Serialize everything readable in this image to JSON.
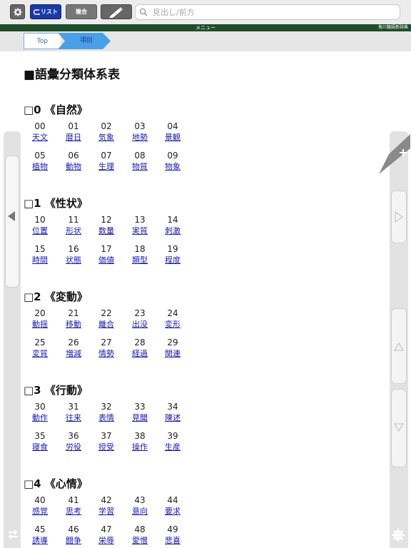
{
  "toolbar": {
    "list_label": "リスト",
    "multi_label": "複合",
    "search_placeholder": "見出し/前方"
  },
  "menubar": {
    "title": "メニュー",
    "dict_name": "角川類語新辞典"
  },
  "breadcrumb": {
    "top": "Top",
    "item": "項目"
  },
  "page_title": "■語彙分類体系表",
  "sections": [
    {
      "heading": "□0 《自然》",
      "rows": [
        [
          [
            "00",
            "天文"
          ],
          [
            "01",
            "暦日"
          ],
          [
            "02",
            "気象"
          ],
          [
            "03",
            "地勢"
          ],
          [
            "04",
            "景観"
          ]
        ],
        [
          [
            "05",
            "植物"
          ],
          [
            "06",
            "動物"
          ],
          [
            "07",
            "生理"
          ],
          [
            "08",
            "物質"
          ],
          [
            "09",
            "物象"
          ]
        ]
      ]
    },
    {
      "heading": "□1 《性状》",
      "rows": [
        [
          [
            "10",
            "位置"
          ],
          [
            "11",
            "形状"
          ],
          [
            "12",
            "数量"
          ],
          [
            "13",
            "実質"
          ],
          [
            "14",
            "刺激"
          ]
        ],
        [
          [
            "15",
            "時間"
          ],
          [
            "16",
            "状態"
          ],
          [
            "17",
            "価値"
          ],
          [
            "18",
            "類型"
          ],
          [
            "19",
            "程度"
          ]
        ]
      ]
    },
    {
      "heading": "□2 《変動》",
      "rows": [
        [
          [
            "20",
            "動揺"
          ],
          [
            "21",
            "移動"
          ],
          [
            "22",
            "離合"
          ],
          [
            "23",
            "出没"
          ],
          [
            "24",
            "変形"
          ]
        ],
        [
          [
            "25",
            "変質"
          ],
          [
            "26",
            "増減"
          ],
          [
            "27",
            "情勢"
          ],
          [
            "28",
            "経過"
          ],
          [
            "29",
            "関連"
          ]
        ]
      ]
    },
    {
      "heading": "□3 《行動》",
      "rows": [
        [
          [
            "30",
            "動作"
          ],
          [
            "31",
            "往来"
          ],
          [
            "32",
            "表情"
          ],
          [
            "33",
            "見聞"
          ],
          [
            "34",
            "陳述"
          ]
        ],
        [
          [
            "35",
            "寝食"
          ],
          [
            "36",
            "労役"
          ],
          [
            "37",
            "授受"
          ],
          [
            "38",
            "操作"
          ],
          [
            "39",
            "生産"
          ]
        ]
      ]
    },
    {
      "heading": "□4 《心情》",
      "rows": [
        [
          [
            "40",
            "感覚"
          ],
          [
            "41",
            "思考"
          ],
          [
            "42",
            "学習"
          ],
          [
            "43",
            "意向"
          ],
          [
            "44",
            "要求"
          ]
        ],
        [
          [
            "45",
            "誘導"
          ],
          [
            "46",
            "闘争"
          ],
          [
            "47",
            "栄辱"
          ],
          [
            "48",
            "愛憎"
          ],
          [
            "49",
            "悲喜"
          ]
        ]
      ]
    }
  ]
}
